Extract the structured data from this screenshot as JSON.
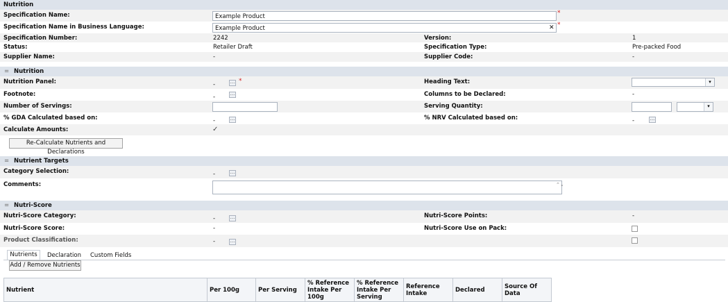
{
  "top": {
    "section_title": "Nutrition",
    "spec_name_label": "Specification Name:",
    "spec_name_value": "Example Product",
    "spec_name_bl_label": "Specification Name in Business Language:",
    "spec_name_bl_value": "Example Product",
    "clear_glyph": "✕",
    "required_mark": "*",
    "spec_number_label": "Specification Number:",
    "spec_number_value": "2242",
    "version_label": "Version:",
    "version_value": "1",
    "status_label": "Status:",
    "status_value": "Retailer Draft",
    "spec_type_label": "Specification Type:",
    "spec_type_value": "Pre-packed Food",
    "supplier_name_label": "Supplier Name:",
    "supplier_name_value": "-",
    "supplier_code_label": "Supplier Code:",
    "supplier_code_value": "-"
  },
  "nutrition": {
    "title": "Nutrition",
    "collapse_glyph": "=",
    "panel_label": "Nutrition Panel:",
    "panel_value": "-",
    "heading_label": "Heading Text:",
    "footnote_label": "Footnote:",
    "footnote_value": "-",
    "columns_label": "Columns to be Declared:",
    "columns_value": "-",
    "servings_label": "Number of Servings:",
    "serving_qty_label": "Serving Quantity:",
    "gda_label": "% GDA Calculated based on:",
    "gda_value": "-",
    "nrv_label": "% NRV Calculated based on:",
    "nrv_value": "-",
    "calc_label": "Calculate Amounts:",
    "calc_check": "✓",
    "recalc_button": "Re-Calculate Nutrients and Declarations"
  },
  "targets": {
    "title": "Nutrient Targets",
    "category_label": "Category Selection:",
    "category_value": "-",
    "comments_label": "Comments:"
  },
  "nutriscore": {
    "title": "Nutri-Score",
    "category_label": "Nutri-Score Category:",
    "category_value": "-",
    "points_label": "Nutri-Score Points:",
    "points_value": "-",
    "score_label": "Nutri-Score Score:",
    "score_value": "-",
    "use_on_pack_label": "Nutri-Score Use on Pack:",
    "classification_label": "Product Classification:",
    "classification_value": "-"
  },
  "tabs": [
    "Nutrients",
    "Declaration",
    "Custom Fields"
  ],
  "add_remove_button": "Add / Remove Nutrients",
  "table": {
    "columns": [
      "Nutrient",
      "Per 100g",
      "Per Serving",
      "% Reference Intake Per 100g",
      "% Reference Intake Per Serving",
      "Reference Intake",
      "Declared",
      "Source Of Data"
    ]
  },
  "icons": {
    "ellipsis": "...",
    "dropdown": "▾",
    "spinner": "⌃⌄"
  }
}
